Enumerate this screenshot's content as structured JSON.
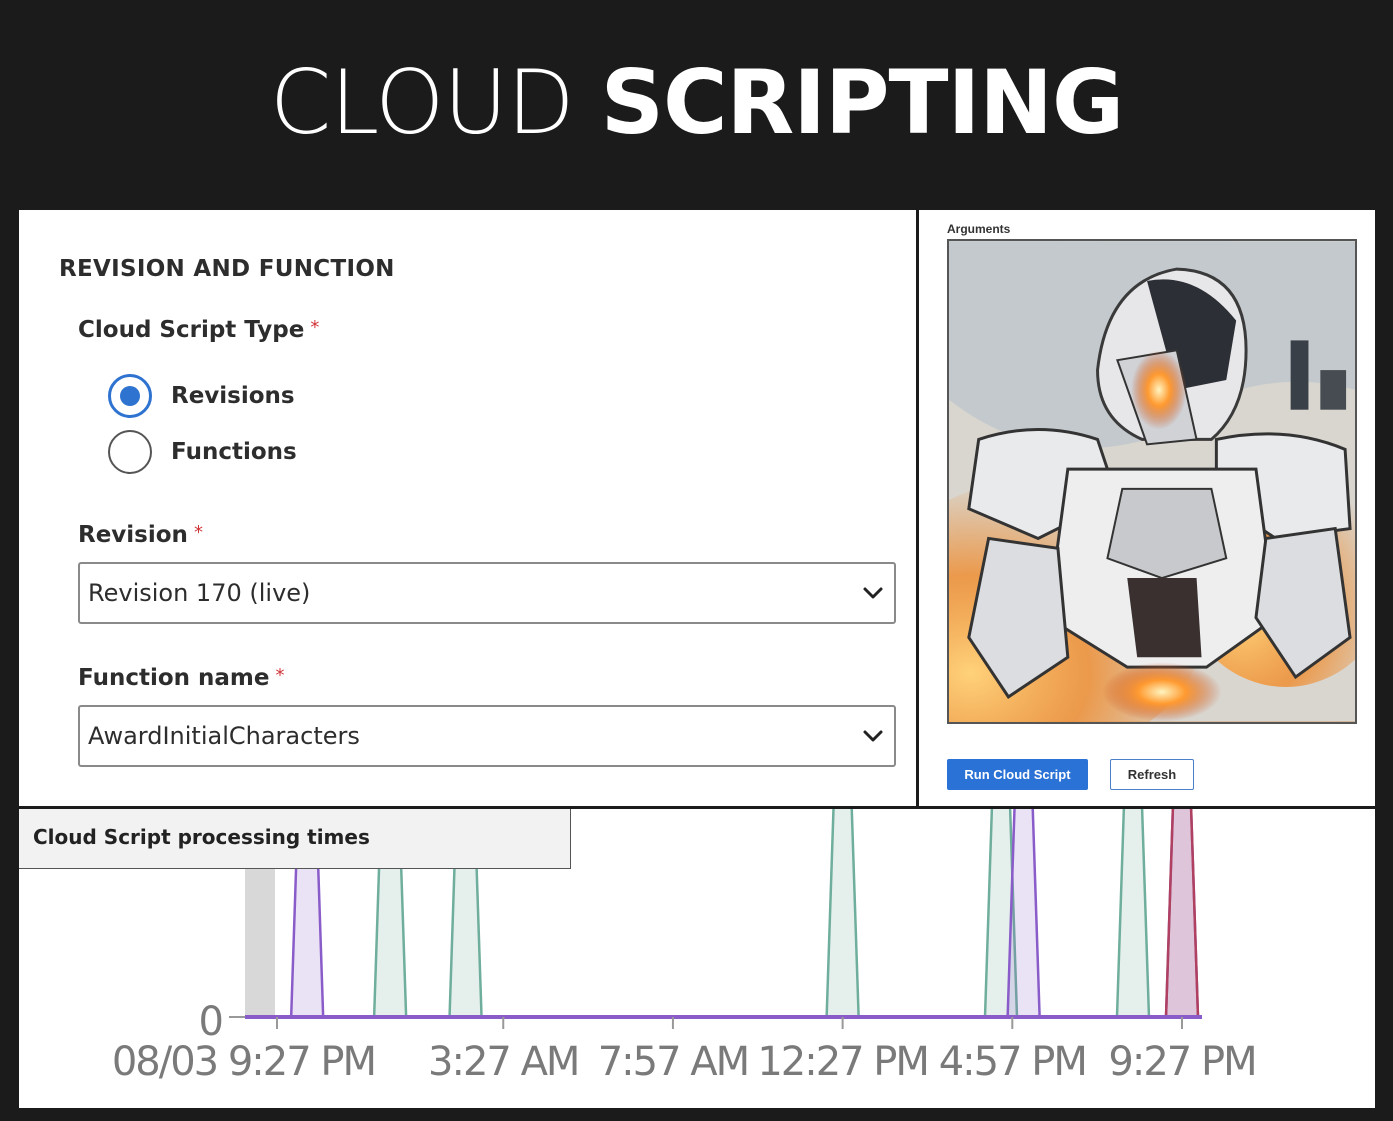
{
  "banner": {
    "title_light": "CLOUD",
    "title_bold": "SCRIPTING"
  },
  "form": {
    "section_title": "REVISION AND FUNCTION",
    "type_label": "Cloud Script Type",
    "required_mark": "*",
    "radio_options": [
      {
        "label": "Revisions",
        "checked": true
      },
      {
        "label": "Functions",
        "checked": false
      }
    ],
    "revision_label": "Revision",
    "revision_value": "Revision 170 (live)",
    "function_label": "Function name",
    "function_value": "AwardInitialCharacters"
  },
  "arguments": {
    "label": "Arguments",
    "image_icon": "armored-robot-soldier-artwork"
  },
  "actions": {
    "run_label": "Run Cloud Script",
    "refresh_label": "Refresh",
    "accent": "#2a72d5"
  },
  "chart_header": {
    "title": "Cloud Script processing times"
  },
  "chart_data": {
    "type": "area",
    "title": "Cloud Script processing times",
    "y_tick_labels": [
      "0"
    ],
    "x_tick_labels": [
      "08/03 9:27 PM",
      "3:27 AM",
      "7:57 AM",
      "12:27 PM",
      "4:57 PM",
      "9:27 PM"
    ],
    "x_hours": [
      0,
      6,
      10.5,
      15,
      19.5,
      24
    ],
    "grid": false,
    "series": [
      {
        "color": "#6fae9c",
        "spikes": [
          {
            "x": 3,
            "y": 1
          },
          {
            "x": 5,
            "y": 1
          },
          {
            "x": 15,
            "y": 1
          },
          {
            "x": 19.2,
            "y": 1
          },
          {
            "x": 22.7,
            "y": 1
          }
        ]
      },
      {
        "color": "#8a5cc9",
        "spikes": [
          {
            "x": 0.8,
            "y": 1
          },
          {
            "x": 19.8,
            "y": 1
          },
          {
            "x": 24,
            "y": 1
          }
        ]
      },
      {
        "color": "#b04060",
        "spikes": [
          {
            "x": 24,
            "y": 1
          }
        ]
      }
    ]
  }
}
